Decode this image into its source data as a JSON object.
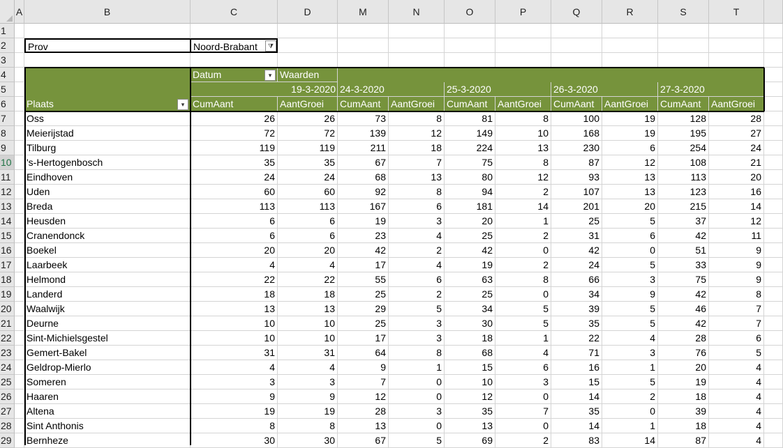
{
  "columns": [
    "A",
    "B",
    "C",
    "D",
    "M",
    "N",
    "O",
    "P",
    "Q",
    "R",
    "S",
    "T"
  ],
  "rows": [
    "1",
    "2",
    "3",
    "4",
    "5",
    "6",
    "7",
    "8",
    "9",
    "10",
    "11",
    "12",
    "13",
    "14",
    "15",
    "16",
    "17",
    "18",
    "19",
    "20",
    "21",
    "22",
    "23",
    "24",
    "25",
    "26",
    "27",
    "28",
    "29"
  ],
  "selected_row": "10",
  "filter": {
    "label": "Prov",
    "value": "Noord-Brabant"
  },
  "pivot": {
    "datum_label": "Datum",
    "waarden_label": "Waarden",
    "plaats_label": "Plaats",
    "dates": [
      "19-3-2020",
      "24-3-2020",
      "25-3-2020",
      "26-3-2020",
      "27-3-2020"
    ],
    "measures": [
      "CumAant",
      "AantGroei"
    ],
    "rows": [
      {
        "name": "Oss",
        "values": [
          26,
          26,
          73,
          8,
          81,
          8,
          100,
          19,
          128,
          28
        ]
      },
      {
        "name": "Meierijstad",
        "values": [
          72,
          72,
          139,
          12,
          149,
          10,
          168,
          19,
          195,
          27
        ]
      },
      {
        "name": "Tilburg",
        "values": [
          119,
          119,
          211,
          18,
          224,
          13,
          230,
          6,
          254,
          24
        ]
      },
      {
        "name": "'s-Hertogenbosch",
        "values": [
          35,
          35,
          67,
          7,
          75,
          8,
          87,
          12,
          108,
          21
        ]
      },
      {
        "name": "Eindhoven",
        "values": [
          24,
          24,
          68,
          13,
          80,
          12,
          93,
          13,
          113,
          20
        ]
      },
      {
        "name": "Uden",
        "values": [
          60,
          60,
          92,
          8,
          94,
          2,
          107,
          13,
          123,
          16
        ]
      },
      {
        "name": "Breda",
        "values": [
          113,
          113,
          167,
          6,
          181,
          14,
          201,
          20,
          215,
          14
        ]
      },
      {
        "name": "Heusden",
        "values": [
          6,
          6,
          19,
          3,
          20,
          1,
          25,
          5,
          37,
          12
        ]
      },
      {
        "name": "Cranendonck",
        "values": [
          6,
          6,
          23,
          4,
          25,
          2,
          31,
          6,
          42,
          11
        ]
      },
      {
        "name": "Boekel",
        "values": [
          20,
          20,
          42,
          2,
          42,
          0,
          42,
          0,
          51,
          9
        ]
      },
      {
        "name": "Laarbeek",
        "values": [
          4,
          4,
          17,
          4,
          19,
          2,
          24,
          5,
          33,
          9
        ]
      },
      {
        "name": "Helmond",
        "values": [
          22,
          22,
          55,
          6,
          63,
          8,
          66,
          3,
          75,
          9
        ]
      },
      {
        "name": "Landerd",
        "values": [
          18,
          18,
          25,
          2,
          25,
          0,
          34,
          9,
          42,
          8
        ]
      },
      {
        "name": "Waalwijk",
        "values": [
          13,
          13,
          29,
          5,
          34,
          5,
          39,
          5,
          46,
          7
        ]
      },
      {
        "name": "Deurne",
        "values": [
          10,
          10,
          25,
          3,
          30,
          5,
          35,
          5,
          42,
          7
        ]
      },
      {
        "name": "Sint-Michielsgestel",
        "values": [
          10,
          10,
          17,
          3,
          18,
          1,
          22,
          4,
          28,
          6
        ]
      },
      {
        "name": "Gemert-Bakel",
        "values": [
          31,
          31,
          64,
          8,
          68,
          4,
          71,
          3,
          76,
          5
        ]
      },
      {
        "name": "Geldrop-Mierlo",
        "values": [
          4,
          4,
          9,
          1,
          15,
          6,
          16,
          1,
          20,
          4
        ]
      },
      {
        "name": "Someren",
        "values": [
          3,
          3,
          7,
          0,
          10,
          3,
          15,
          5,
          19,
          4
        ]
      },
      {
        "name": "Haaren",
        "values": [
          9,
          9,
          12,
          0,
          12,
          0,
          14,
          2,
          18,
          4
        ]
      },
      {
        "name": "Altena",
        "values": [
          19,
          19,
          28,
          3,
          35,
          7,
          35,
          0,
          39,
          4
        ]
      },
      {
        "name": "Sint Anthonis",
        "values": [
          8,
          8,
          13,
          0,
          13,
          0,
          14,
          1,
          18,
          4
        ]
      },
      {
        "name": "Bernheze",
        "values": [
          30,
          30,
          67,
          5,
          69,
          2,
          83,
          14,
          87,
          4
        ]
      }
    ]
  }
}
